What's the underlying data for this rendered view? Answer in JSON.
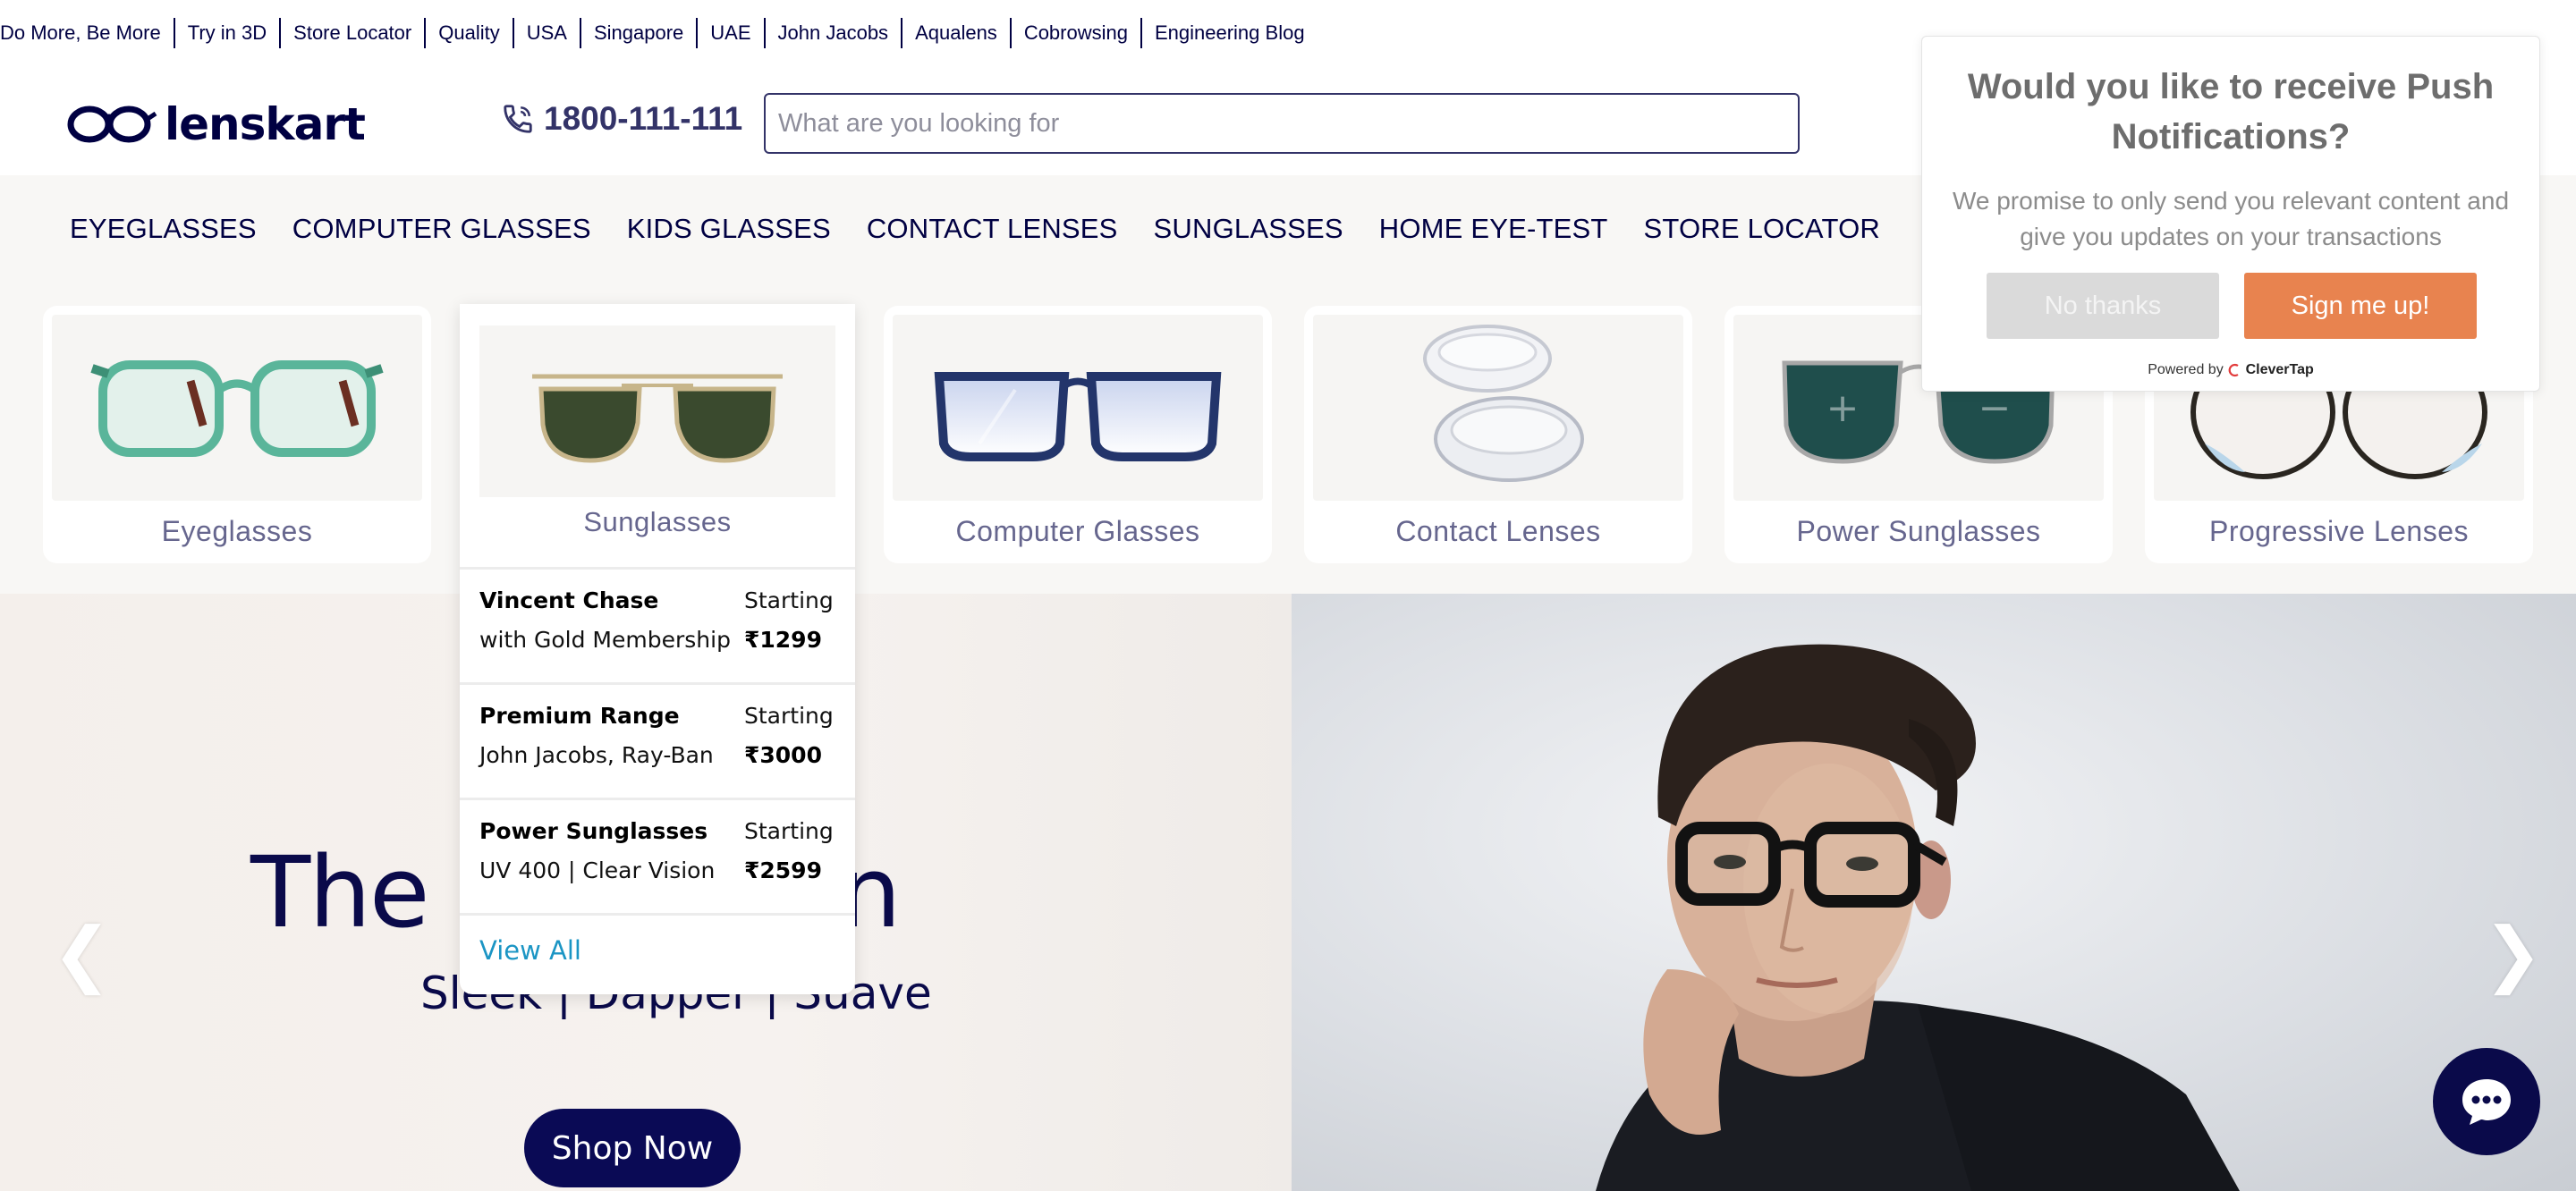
{
  "top_links": [
    "Do More, Be More",
    "Try in 3D",
    "Store Locator",
    "Quality",
    "USA",
    "Singapore",
    "UAE",
    "John Jacobs",
    "Aqualens",
    "Cobrowsing",
    "Engineering Blog"
  ],
  "header": {
    "logo_text": "lenskart",
    "phone": "1800-111-111",
    "search_placeholder": "What are you looking for"
  },
  "nav": [
    "EYEGLASSES",
    "COMPUTER GLASSES",
    "KIDS GLASSES",
    "CONTACT LENSES",
    "SUNGLASSES",
    "HOME EYE-TEST",
    "STORE LOCATOR"
  ],
  "categories": [
    "Eyeglasses",
    "Sunglasses",
    "Computer Glasses",
    "Contact Lenses",
    "Power Sunglasses",
    "Progressive Lenses"
  ],
  "dropdown": {
    "title": "Sunglasses",
    "rows": [
      {
        "name": "Vincent Chase",
        "desc": "with Gold Membership",
        "start": "Starting",
        "price": "₹1299"
      },
      {
        "name": "Premium Range",
        "desc": "John Jacobs, Ray-Ban",
        "start": "Starting",
        "price": "₹3000"
      },
      {
        "name": "Power Sunglasses",
        "desc": "UV 400 | Clear Vision",
        "start": "Starting",
        "price": "₹2599"
      }
    ],
    "view_all": "View All"
  },
  "hero": {
    "title": "The Bold Man",
    "subtitle": "Sleek | Dapper | Suave",
    "button": "Shop Now"
  },
  "push": {
    "title": "Would you like to receive Push Notifications?",
    "body": "We promise to only send you relevant content and give you updates on your transactions",
    "no_button": "No thanks",
    "yes_button": "Sign me up!",
    "powered_by": "Powered by",
    "brand": "CleverTap"
  },
  "colors": {
    "brand_navy": "#000042",
    "nav_bg": "#f8f7f5",
    "accent_orange": "#e8834f",
    "link_blue": "#1b95c4"
  }
}
